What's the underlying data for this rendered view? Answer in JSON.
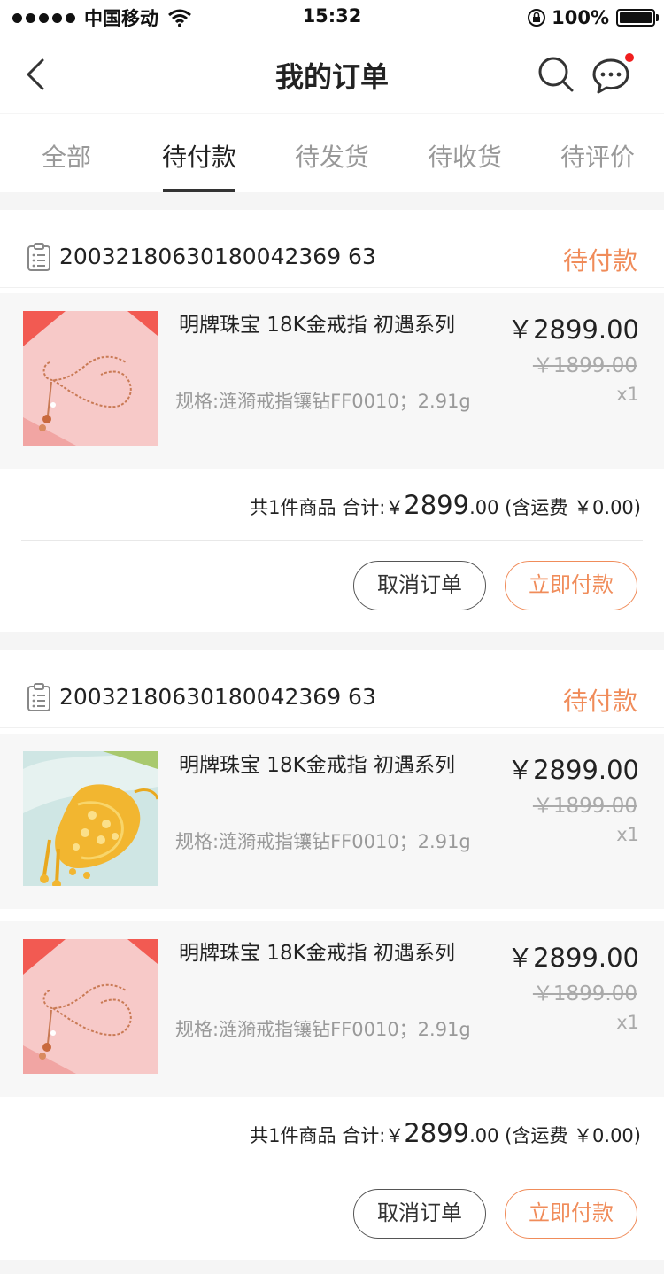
{
  "status_bar": {
    "carrier": "中国移动",
    "time": "15:32",
    "battery": "100%"
  },
  "header": {
    "title": "我的订单"
  },
  "tabs": [
    {
      "label": "全部"
    },
    {
      "label": "待付款"
    },
    {
      "label": "待发货"
    },
    {
      "label": "待收货"
    },
    {
      "label": "待评价"
    }
  ],
  "active_tab": "待付款",
  "colors": {
    "accent": "#f08c5a",
    "badge": "#f01e1e"
  },
  "orders": [
    {
      "order_no": "20032180630180042369 63",
      "status": "待付款",
      "items": [
        {
          "name": "明牌珠宝 18K金戒指 初遇系列",
          "spec": "规格:涟漪戒指镶钻FF0010；2.91g",
          "price": "￥2899.00",
          "original_price": "￥1899.00",
          "qty": "x1",
          "image": "rose-gold-ring-chain"
        }
      ],
      "summary_prefix": "共1件商品 合计:￥",
      "summary_big": "2899",
      "summary_suffix": ".00 (含运费 ￥0.00)",
      "cancel_label": "取消订单",
      "pay_label": "立即付款"
    },
    {
      "order_no": "20032180630180042369 63",
      "status": "待付款",
      "items": [
        {
          "name": "明牌珠宝 18K金戒指 初遇系列",
          "spec": "规格:涟漪戒指镶钻FF0010；2.91g",
          "price": "￥2899.00",
          "original_price": "￥1899.00",
          "qty": "x1",
          "image": "gold-pendant"
        },
        {
          "name": "明牌珠宝 18K金戒指 初遇系列",
          "spec": "规格:涟漪戒指镶钻FF0010；2.91g",
          "price": "￥2899.00",
          "original_price": "￥1899.00",
          "qty": "x1",
          "image": "rose-gold-ring-chain"
        }
      ],
      "summary_prefix": "共1件商品 合计:￥",
      "summary_big": "2899",
      "summary_suffix": ".00 (含运费 ￥0.00)",
      "cancel_label": "取消订单",
      "pay_label": "立即付款"
    }
  ]
}
